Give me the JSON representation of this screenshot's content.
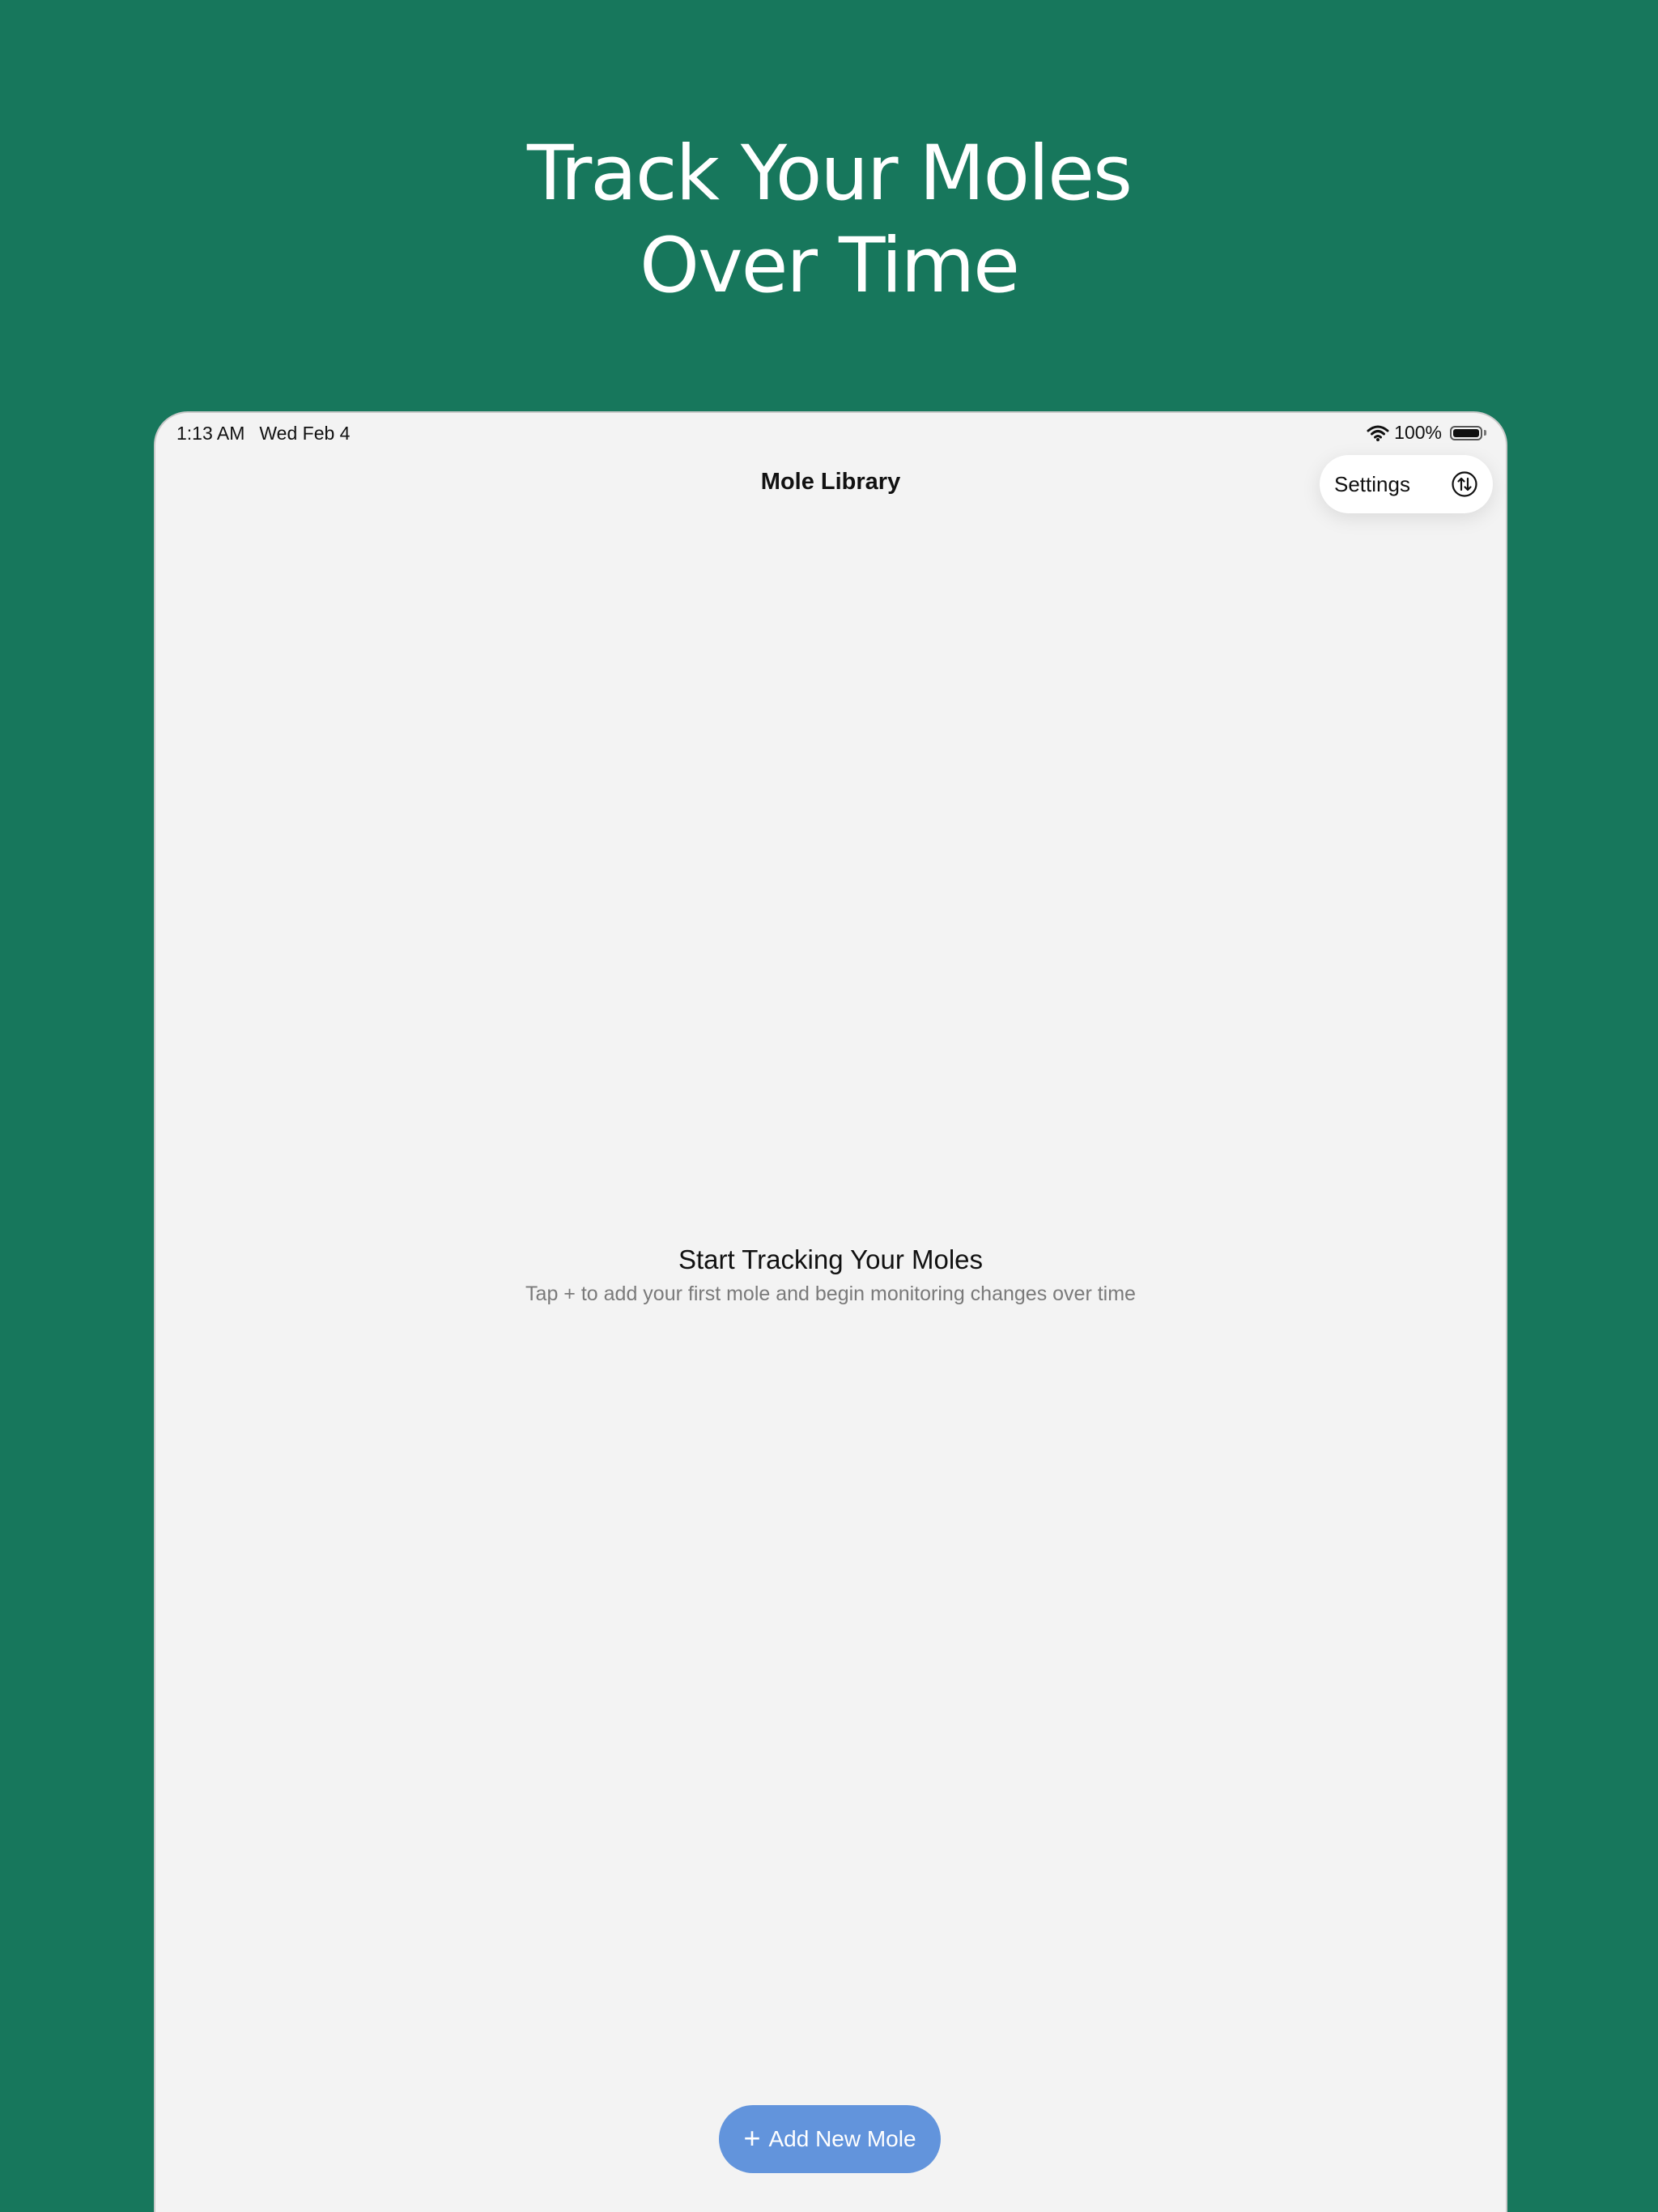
{
  "hero": {
    "line1": "Track Your Moles",
    "line2": "Over Time"
  },
  "status_bar": {
    "time": "1:13 AM",
    "date": "Wed Feb 4",
    "battery_percent": "100%",
    "battery_level": 1.0
  },
  "nav": {
    "title": "Mole Library"
  },
  "menu": {
    "settings_label": "Settings",
    "sort_icon": "sort-arrows-icon"
  },
  "empty_state": {
    "title": "Start Tracking Your Moles",
    "subtitle": "Tap + to add your first mole and begin monitoring changes over time"
  },
  "add_button": {
    "label": "Add New Mole",
    "icon": "plus-icon"
  },
  "colors": {
    "background": "#17775c",
    "screen": "#f3f3f3",
    "accent_button": "#6294dc"
  }
}
